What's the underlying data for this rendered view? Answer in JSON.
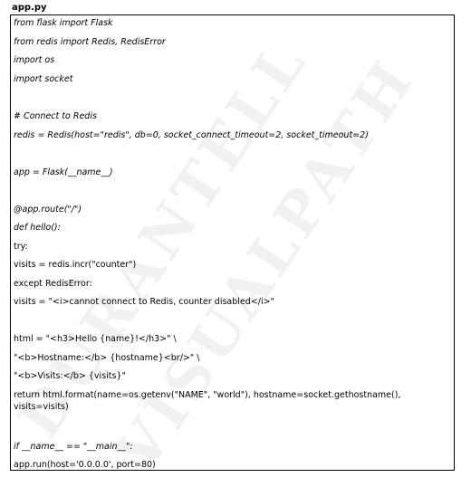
{
  "document": {
    "filename": "app.py",
    "lines": [
      "from flask import Flask",
      "from redis import Redis, RedisError",
      "import os",
      "import socket",
      "# Connect to Redis",
      "redis = Redis(host=\"redis\", db=0, socket_connect_timeout=2, socket_timeout=2)",
      "app = Flask(__name__)",
      "@app.route(\"/\")",
      "def hello():",
      "try:",
      "visits = redis.incr(\"counter\")",
      "except RedisError:",
      "visits = \"<i>cannot connect to Redis, counter disabled</i>\"",
      "html = \"<h3>Hello {name}!</h3>\" \\",
      "\"<b>Hostname:</b> {hostname}<br/>\" \\",
      "\"<b>Visits:</b> {visits}\"",
      "return html.format(name=os.getenv(\"NAME\", \"world\"), hostname=socket.gethostname(), visits=visits)",
      "if __name__ == \"__main__\":",
      "app.run(host='0.0.0.0', port=80)"
    ]
  },
  "watermark": {
    "line1": "DURANTELL",
    "line2": "VISUALPATH"
  }
}
